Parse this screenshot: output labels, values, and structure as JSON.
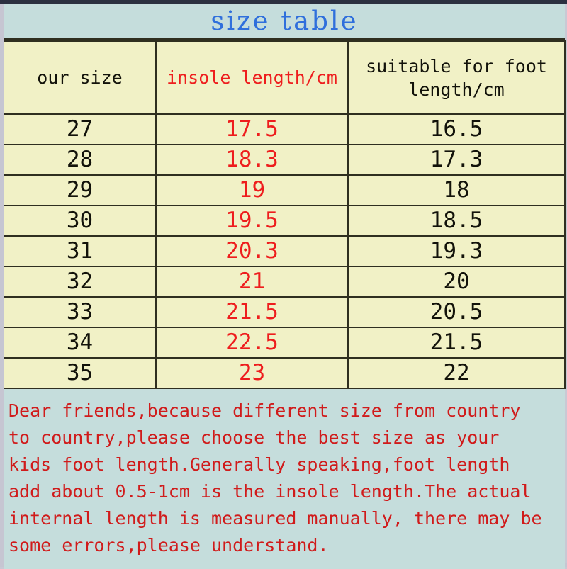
{
  "title": {
    "text": "size table",
    "color": "#2f6fdc"
  },
  "palette": {
    "title_band_bg": "#c5dddc",
    "table_cell_bg": "#f1f1c6",
    "note_bg": "#c5dddc",
    "border": "#2f2f20",
    "red_text": "#ee1d1d",
    "black_text": "#12120a",
    "note_red": "#d01b1b",
    "page_gutter": "#c6c6d2",
    "top_rule": "#2b3040"
  },
  "table": {
    "columns": [
      {
        "label": "our size",
        "color": "black"
      },
      {
        "label": "insole length/cm",
        "color": "red"
      },
      {
        "label": "suitable for foot length/cm",
        "color": "black"
      }
    ],
    "rows": [
      {
        "our_size": "27",
        "insole_length_cm": "17.5",
        "foot_length_cm": "16.5"
      },
      {
        "our_size": "28",
        "insole_length_cm": "18.3",
        "foot_length_cm": "17.3"
      },
      {
        "our_size": "29",
        "insole_length_cm": "19",
        "foot_length_cm": "18"
      },
      {
        "our_size": "30",
        "insole_length_cm": "19.5",
        "foot_length_cm": "18.5"
      },
      {
        "our_size": "31",
        "insole_length_cm": "20.3",
        "foot_length_cm": "19.3"
      },
      {
        "our_size": "32",
        "insole_length_cm": "21",
        "foot_length_cm": "20"
      },
      {
        "our_size": "33",
        "insole_length_cm": "21.5",
        "foot_length_cm": "20.5"
      },
      {
        "our_size": "34",
        "insole_length_cm": "22.5",
        "foot_length_cm": "21.5"
      },
      {
        "our_size": "35",
        "insole_length_cm": "23",
        "foot_length_cm": "22"
      }
    ]
  },
  "note": {
    "lines": [
      "Dear friends,because different size from country",
      "to country,please choose the best size as your",
      "kids foot length.Generally speaking,foot length",
      "add about 0.5-1cm is the insole length.The actual",
      "internal length is measured manually, there may be",
      "some errors,please understand."
    ]
  }
}
